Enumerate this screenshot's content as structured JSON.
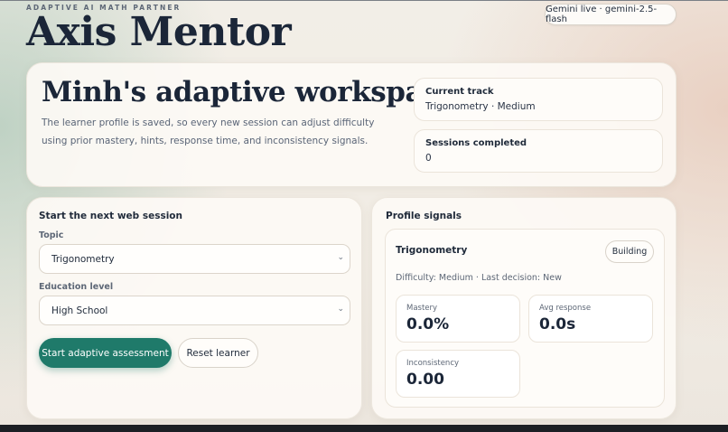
{
  "header": {
    "kicker": "ADAPTIVE AI MATH PARTNER",
    "brand": "Axis Mentor",
    "model_status": "Gemini live · gemini-2.5-flash"
  },
  "hero": {
    "title": "Minh's adaptive workspace",
    "description": "The learner profile is saved, so every new session can adjust difficulty using prior mastery, hints, response time, and inconsistency signals.",
    "current_track": {
      "label": "Current track",
      "value": "Trigonometry · Medium"
    },
    "sessions": {
      "label": "Sessions completed",
      "value": "0"
    }
  },
  "session_form": {
    "title": "Start the next web session",
    "topic_label": "Topic",
    "topic_value": "Trigonometry",
    "education_label": "Education level",
    "education_value": "High School",
    "start_button": "Start adaptive assessment",
    "reset_button": "Reset learner"
  },
  "profile_signals": {
    "title": "Profile signals",
    "topic": "Trigonometry",
    "status_badge": "Building",
    "meta": "Difficulty: Medium · Last decision: New",
    "metrics": [
      {
        "label": "Mastery",
        "value": "0.0%"
      },
      {
        "label": "Avg response",
        "value": "0.0s"
      },
      {
        "label": "Inconsistency",
        "value": "0.00"
      }
    ]
  },
  "colors": {
    "accent": "#1f7a6a",
    "heading": "#1b2638"
  }
}
